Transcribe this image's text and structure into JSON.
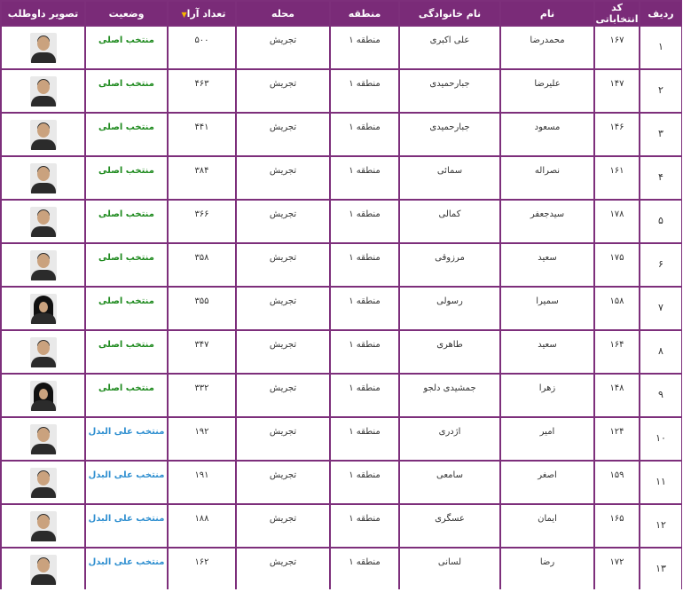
{
  "headers": {
    "row": "ردیف",
    "code": "کد انتخاباتی",
    "first_name": "نام",
    "last_name": "نام خانوادگی",
    "region": "منطقه",
    "area": "محله",
    "votes": "تعداد آرا",
    "status": "وضعیت",
    "photo": "تصویر داوطلب"
  },
  "rows": [
    {
      "row": "۱",
      "code": "۱۶۷",
      "first_name": "محمدرضا",
      "last_name": "علی اکبری",
      "region": "منطقه ۱",
      "area": "تجریش",
      "votes": "۵۰۰",
      "status": "منتخب اصلی",
      "type": "main"
    },
    {
      "row": "۲",
      "code": "۱۴۷",
      "first_name": "علیرضا",
      "last_name": "جبارحمیدی",
      "region": "منطقه ۱",
      "area": "تجریش",
      "votes": "۴۶۳",
      "status": "منتخب اصلی",
      "type": "main"
    },
    {
      "row": "۳",
      "code": "۱۴۶",
      "first_name": "مسعود",
      "last_name": "جبارحمیدی",
      "region": "منطقه ۱",
      "area": "تجریش",
      "votes": "۴۴۱",
      "status": "منتخب اصلی",
      "type": "main"
    },
    {
      "row": "۴",
      "code": "۱۶۱",
      "first_name": "نصراله",
      "last_name": "سمائی",
      "region": "منطقه ۱",
      "area": "تجریش",
      "votes": "۳۸۴",
      "status": "منتخب اصلی",
      "type": "main"
    },
    {
      "row": "۵",
      "code": "۱۷۸",
      "first_name": "سیدجعفر",
      "last_name": "کمالی",
      "region": "منطقه ۱",
      "area": "تجریش",
      "votes": "۳۶۶",
      "status": "منتخب اصلی",
      "type": "main"
    },
    {
      "row": "۶",
      "code": "۱۷۵",
      "first_name": "سعید",
      "last_name": "مرزوقی",
      "region": "منطقه ۱",
      "area": "تجریش",
      "votes": "۳۵۸",
      "status": "منتخب اصلی",
      "type": "main"
    },
    {
      "row": "۷",
      "code": "۱۵۸",
      "first_name": "سمیرا",
      "last_name": "رسولی",
      "region": "منطقه ۱",
      "area": "تجریش",
      "votes": "۳۵۵",
      "status": "منتخب اصلی",
      "type": "main",
      "female": true
    },
    {
      "row": "۸",
      "code": "۱۶۴",
      "first_name": "سعید",
      "last_name": "طاهری",
      "region": "منطقه ۱",
      "area": "تجریش",
      "votes": "۳۴۷",
      "status": "منتخب اصلی",
      "type": "main"
    },
    {
      "row": "۹",
      "code": "۱۴۸",
      "first_name": "زهرا",
      "last_name": "جمشیدی دلجو",
      "region": "منطقه ۱",
      "area": "تجریش",
      "votes": "۳۳۲",
      "status": "منتخب اصلی",
      "type": "main",
      "female": true
    },
    {
      "row": "۱۰",
      "code": "۱۲۴",
      "first_name": "امیر",
      "last_name": "اژدری",
      "region": "منطقه ۱",
      "area": "تجریش",
      "votes": "۱۹۲",
      "status": "منتخب علی البدل",
      "type": "alt"
    },
    {
      "row": "۱۱",
      "code": "۱۵۹",
      "first_name": "اصغر",
      "last_name": "سامعی",
      "region": "منطقه ۱",
      "area": "تجریش",
      "votes": "۱۹۱",
      "status": "منتخب علی البدل",
      "type": "alt"
    },
    {
      "row": "۱۲",
      "code": "۱۶۵",
      "first_name": "ایمان",
      "last_name": "عسگری",
      "region": "منطقه ۱",
      "area": "تجریش",
      "votes": "۱۸۸",
      "status": "منتخب علی البدل",
      "type": "alt"
    },
    {
      "row": "۱۳",
      "code": "۱۷۲",
      "first_name": "رضا",
      "last_name": "لسانی",
      "region": "منطقه ۱",
      "area": "تجریش",
      "votes": "۱۶۲",
      "status": "منتخب علی البدل",
      "type": "alt"
    }
  ],
  "colors": {
    "header_bg": "#7a2b78",
    "border": "#7d2f7b",
    "status_main": "#1e8a1e",
    "status_alt": "#2f8fd0",
    "sort_indicator": "#f5b400"
  },
  "icons": {
    "sort": "sort-down-icon",
    "photo": "candidate-photo"
  }
}
